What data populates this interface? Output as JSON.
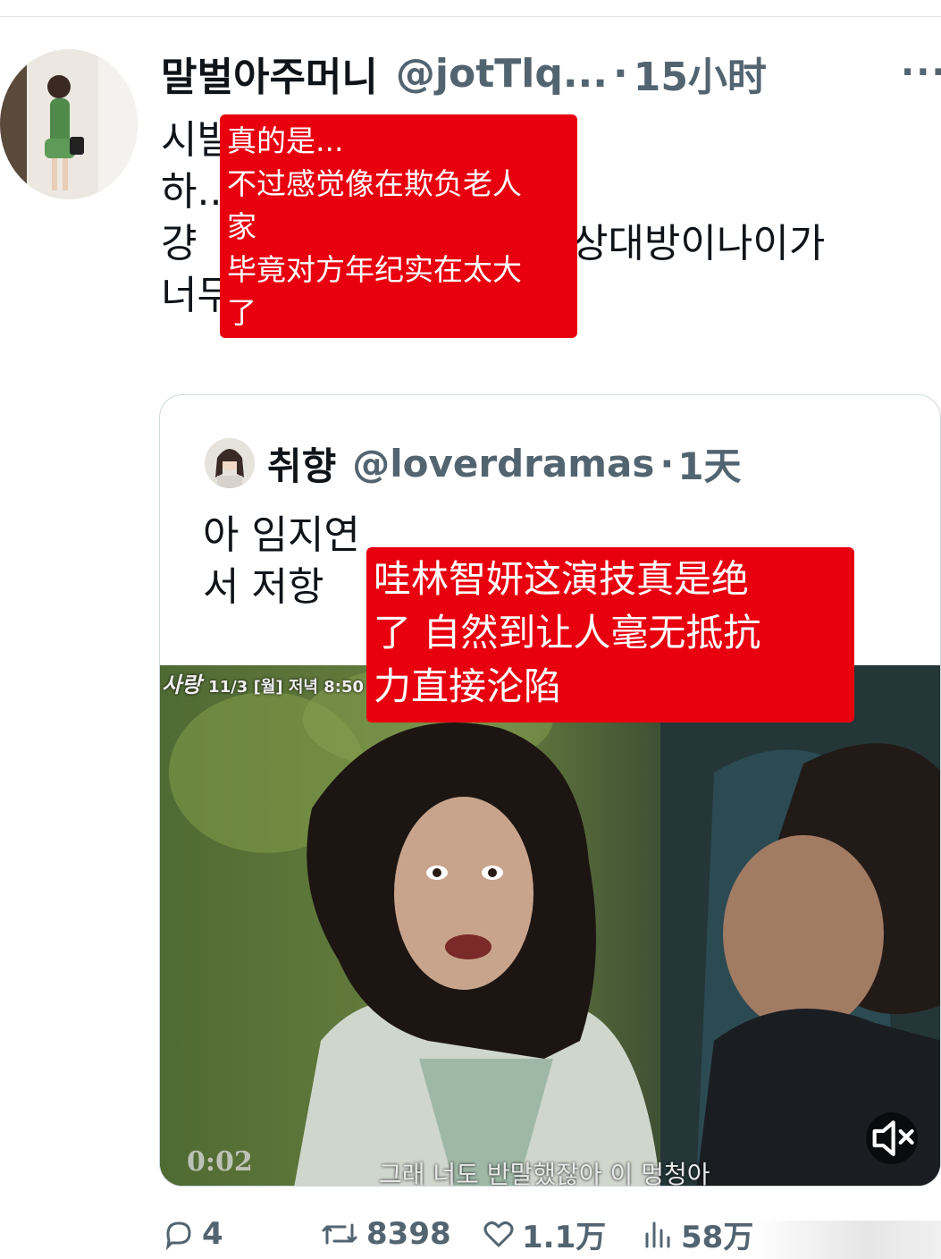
{
  "tweet": {
    "author_name": "말벌아주머니",
    "author_handle": "@jotTlq...",
    "separator": "·",
    "time_ago": "15小时",
    "more_label": "···",
    "text_lines": [
      "시발",
      "하..",
      "걍 ",
      "너무 "
    ],
    "text_line3_tail": "음상대방이나이가",
    "translation_lines": [
      "真的是...",
      "不过感觉像在欺负老人",
      "家",
      "毕竟对方年纪实在太大",
      "了"
    ]
  },
  "quote": {
    "author_name": "취향",
    "author_handle": "@loverdramas",
    "separator": "·",
    "time_ago": "1天",
    "text_lines": [
      "아 임지연 ",
      "서 저항"
    ],
    "translation_lines": [
      "哇林智妍这演技真是绝",
      "了 自然到让人毫无抵抗",
      "力直接沦陷"
    ],
    "video": {
      "broadcast_title": "사랑",
      "broadcast_info": "11/3 [월] 저녁 8:50",
      "subtitle": "그래 너도 반말했잖아 이 멍청아",
      "timestamp": "0:02",
      "mute_icon": "speaker-muted-icon"
    }
  },
  "actions": {
    "replies": "4",
    "retweets": "8398",
    "likes": "1.1万",
    "views": "58万"
  },
  "colors": {
    "overlay_red": "#e8000f",
    "muted_text": "#536471",
    "primary_text": "#0f1419"
  }
}
